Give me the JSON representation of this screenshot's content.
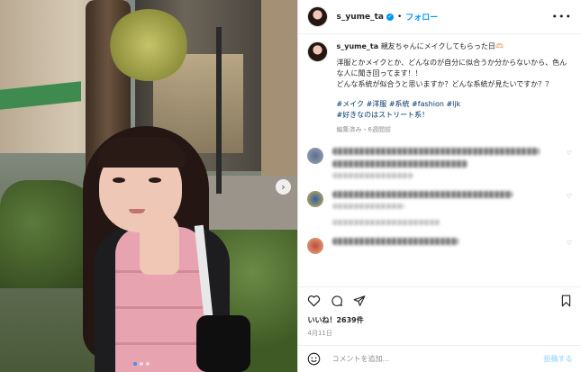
{
  "post": {
    "username": "s_yume_ta",
    "separator": "•",
    "follow_label": "フォロー",
    "more_icon": "more-icon",
    "caption": {
      "username": "s_yume_ta",
      "title": "親友ちゃんにメイクしてもらった日🫶🏻",
      "body": "洋服とかメイクとか、どんなのが自分に似合うか分からないから、色んな人に聞き回ってます！！\nどんな系統が似合うと思いますか？どんな系統が見たいですか？？",
      "tags": "#メイク #洋服 #系統 #fashion #ljk\n#好きなのはストリート系！",
      "meta": "編集済み・6週間前"
    },
    "likes": "いいね！2639件",
    "date": "4月11日",
    "comment_placeholder": "コメントを追加...",
    "post_button": "投稿する",
    "carousel": {
      "slides": 3,
      "active": 0
    }
  },
  "colors": {
    "accent": "#0095f6",
    "link": "#00376b",
    "muted": "#8e8e8e"
  }
}
